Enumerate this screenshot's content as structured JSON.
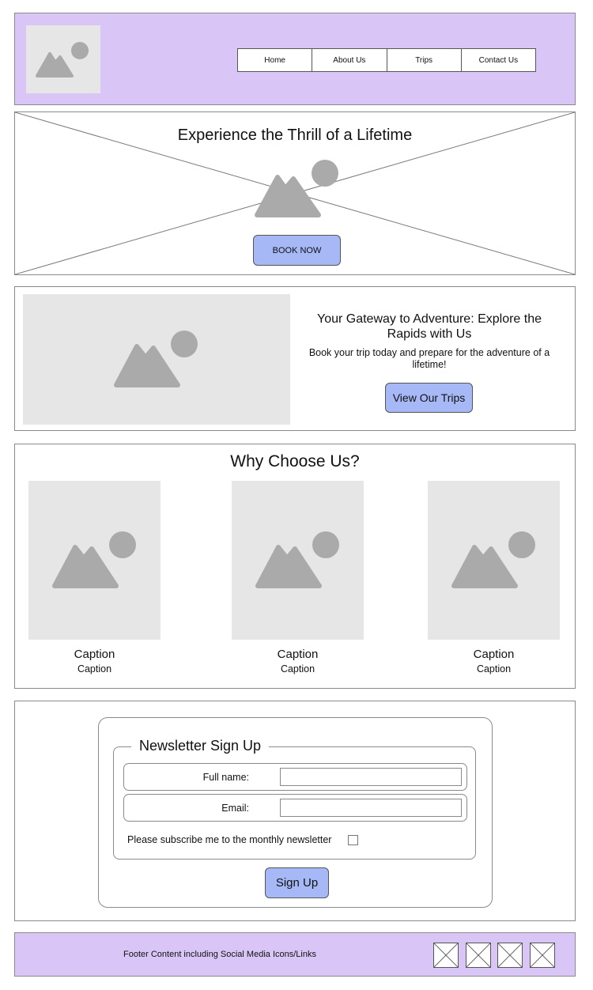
{
  "header": {
    "logo_icon": "image-placeholder-icon",
    "nav": [
      "Home",
      "About Us",
      "Trips",
      "Contact Us"
    ]
  },
  "hero": {
    "title": "Experience the Thrill of a Lifetime",
    "image_icon": "image-placeholder-icon",
    "book_label": "BOOK NOW"
  },
  "adventure": {
    "title": "Your Gateway to Adventure: Explore the Rapids with Us",
    "text": "Book your trip today and prepare for the adventure of a lifetime!",
    "button_label": "View Our Trips"
  },
  "why": {
    "title": "Why Choose Us?",
    "cards": [
      {
        "caption": "Caption",
        "subcaption": "Caption"
      },
      {
        "caption": "Caption",
        "subcaption": "Caption"
      },
      {
        "caption": "Caption",
        "subcaption": "Caption"
      }
    ]
  },
  "newsletter": {
    "legend": "Newsletter Sign Up",
    "name_label": "Full name:",
    "email_label": "Email:",
    "subscribe_label": "Please subscribe me to the monthly newsletter",
    "subscribe_checked": false,
    "button_label": "Sign Up"
  },
  "footer": {
    "text": "Footer Content including Social Media Icons/Links",
    "social_icons": [
      "social-placeholder-icon",
      "social-placeholder-icon",
      "social-placeholder-icon",
      "social-placeholder-icon"
    ]
  },
  "colors": {
    "header_bg": "#d9c6f7",
    "button_bg": "#a6b8f6",
    "placeholder_bg": "#e6e6e6",
    "placeholder_icon": "#aaaaaa"
  }
}
